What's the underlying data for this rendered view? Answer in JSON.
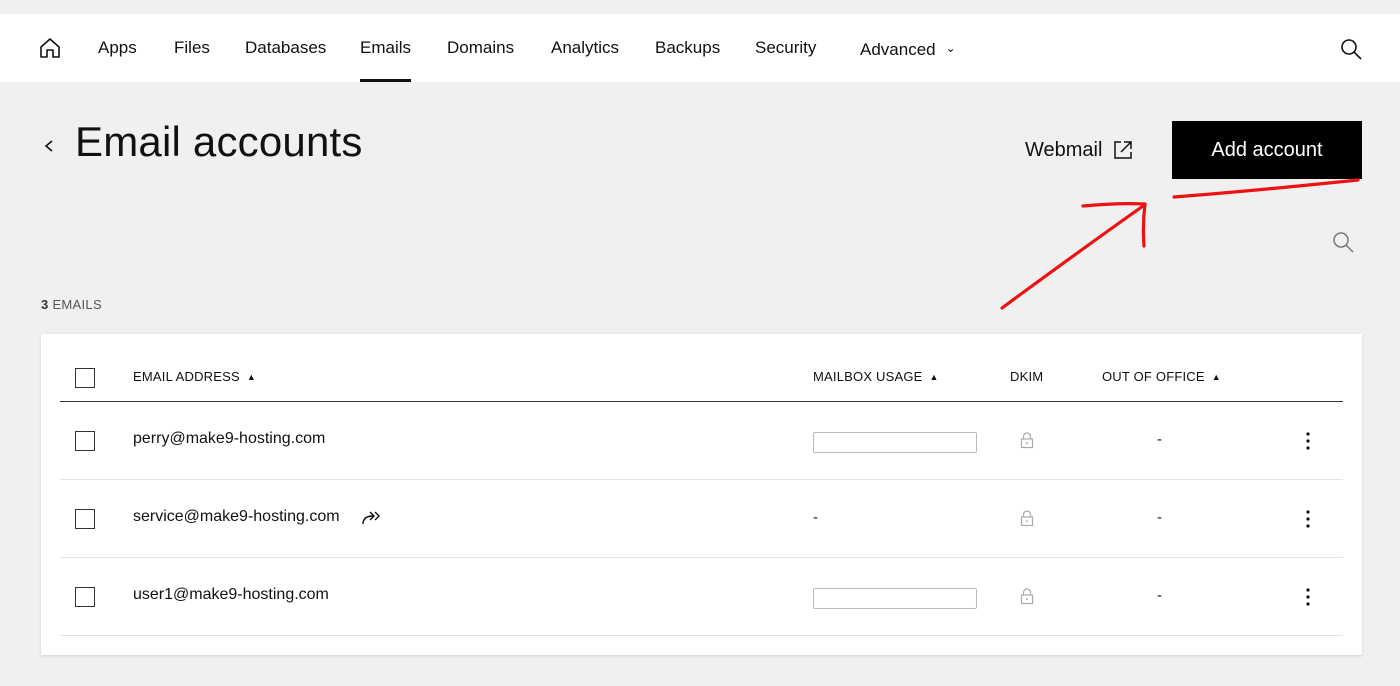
{
  "nav": {
    "items": [
      {
        "label": "Apps"
      },
      {
        "label": "Files"
      },
      {
        "label": "Databases"
      },
      {
        "label": "Emails"
      },
      {
        "label": "Domains"
      },
      {
        "label": "Analytics"
      },
      {
        "label": "Backups"
      },
      {
        "label": "Security"
      },
      {
        "label": "Advanced"
      }
    ],
    "active": "Emails",
    "advanced_chevron": "⌄"
  },
  "header": {
    "title": "Email accounts",
    "webmail_label": "Webmail",
    "add_button_label": "Add account"
  },
  "list": {
    "count_number": "3",
    "count_label": "EMAILS"
  },
  "table": {
    "columns": {
      "email": "EMAIL ADDRESS",
      "usage": "MAILBOX USAGE",
      "dkim": "DKIM",
      "ooo": "OUT OF OFFICE"
    },
    "sort_indicator": "▲",
    "rows": [
      {
        "email": "perry@make9-hosting.com",
        "usage": "",
        "ooo": "-"
      },
      {
        "email": "service@make9-hosting.com",
        "usage": "-",
        "ooo": "-"
      },
      {
        "email": "user1@make9-hosting.com",
        "usage": "",
        "ooo": "-"
      }
    ]
  },
  "colors": {
    "background": "#f0f0f0",
    "primary_button": "#000000",
    "annotation": "#ee1111"
  }
}
